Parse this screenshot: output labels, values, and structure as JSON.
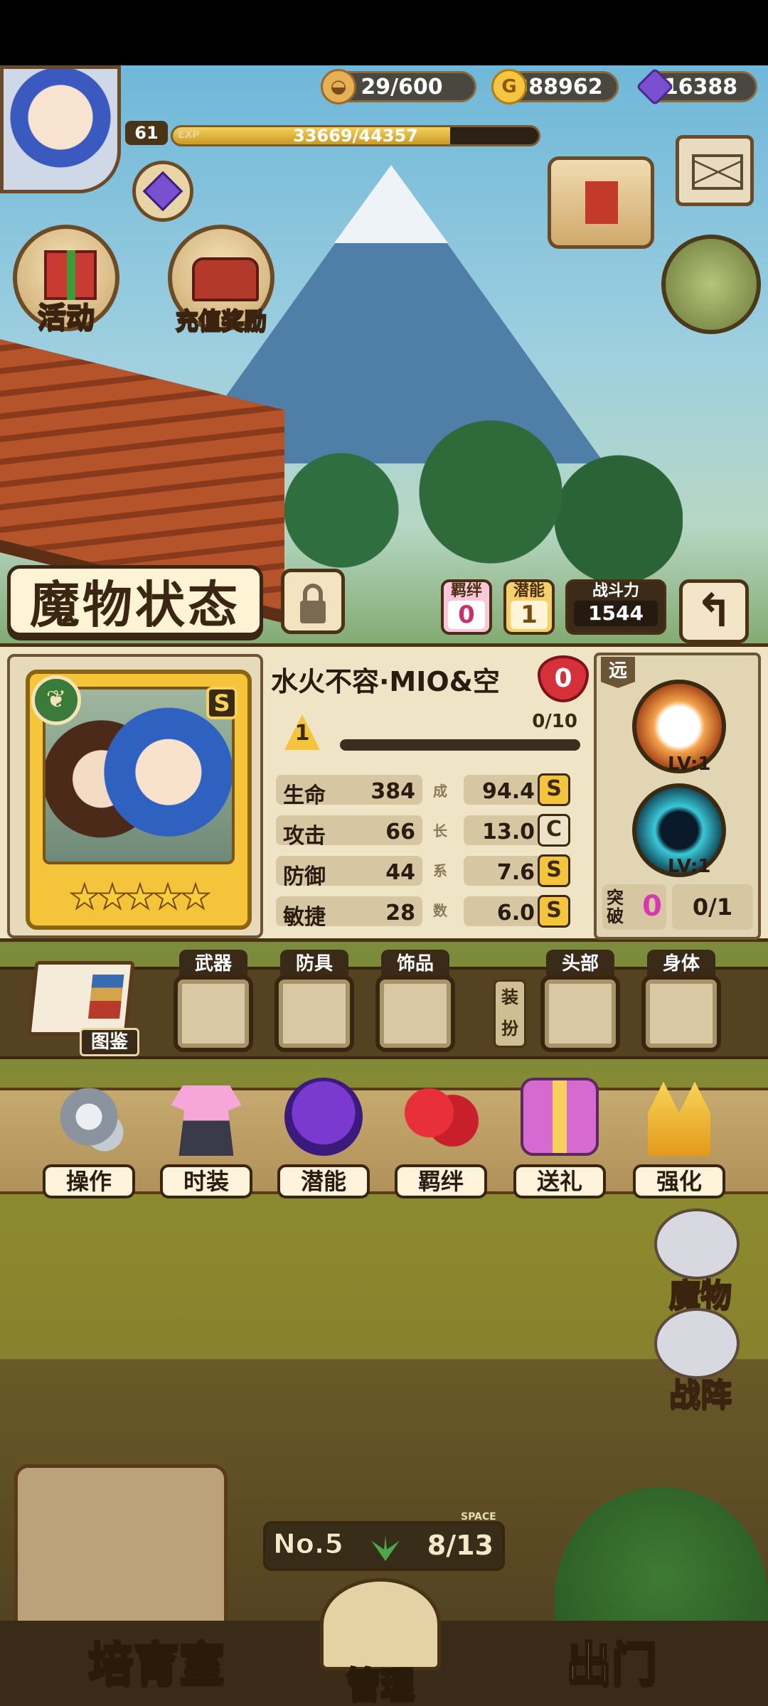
{
  "hud": {
    "stamina": "29/600",
    "gold": "388962",
    "gems": "16388",
    "level": "61",
    "exp_label": "EXP",
    "exp_text": "33669/44357",
    "exp_progress": 0.759
  },
  "left_buttons": {
    "event_label": "活动",
    "recharge_label": "充值奖励"
  },
  "panel_title": "魔物状态",
  "header_stats": {
    "bond_caption": "羁绊",
    "bond_value": "0",
    "potential_caption": "潜能",
    "potential_value": "1",
    "power_caption": "战斗力",
    "power_value": "1544",
    "back_symbol": "↰"
  },
  "monster": {
    "name": "水火不容·MIO&空",
    "favor": "0",
    "element_icon": "leaf-icon",
    "rank": "S",
    "stars": "★★★★★",
    "level": "1",
    "level_progress": "0/10",
    "level_fraction": 0,
    "stats": [
      {
        "name": "生命",
        "value": "384",
        "growth": "94.4",
        "grade": "S"
      },
      {
        "name": "攻击",
        "value": "66",
        "growth": "13.0",
        "grade": "C"
      },
      {
        "name": "防御",
        "value": "44",
        "growth": "7.6",
        "grade": "S"
      },
      {
        "name": "敏捷",
        "value": "28",
        "growth": "6.0",
        "grade": "S"
      }
    ],
    "growth_label": "成长系数",
    "range": "远",
    "skills": [
      {
        "name": "fire-burst-skill",
        "level": "LV:1"
      },
      {
        "name": "vortex-skill",
        "level": "LV:1"
      }
    ],
    "break_label": "突破",
    "break_value": "0",
    "break_count": "0/1"
  },
  "equipment": {
    "book_label": "图鉴",
    "slots": [
      "武器",
      "防具",
      "饰品",
      "头部",
      "身体"
    ],
    "outfit_label": "装扮"
  },
  "actions": [
    "操作",
    "时装",
    "潜能",
    "羁绊",
    "送礼",
    "强化"
  ],
  "side_nav": {
    "monster_label": "魔物",
    "formation_label": "战阵"
  },
  "space": {
    "number": "No.5",
    "caption": "SPACE",
    "value": "8/13"
  },
  "bottom_nav": {
    "breed_label": "培育室",
    "manage_label": "管理",
    "exit_label": "出门"
  }
}
